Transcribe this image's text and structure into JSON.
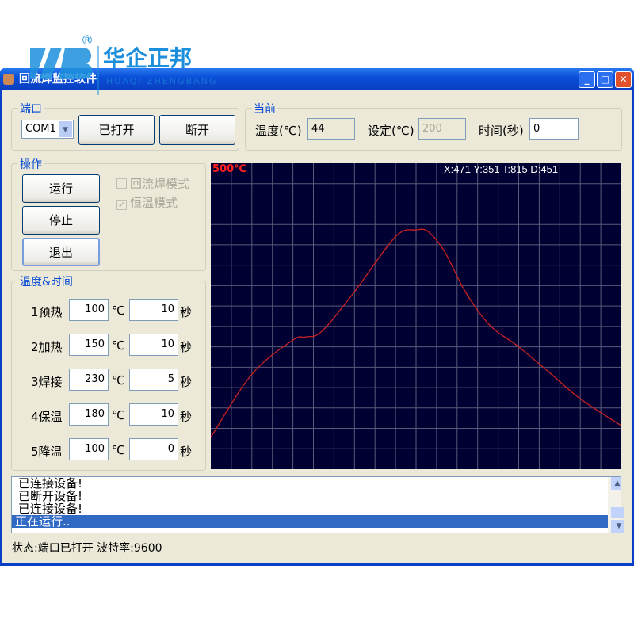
{
  "logo": {
    "brand": "华企正邦",
    "subtitle": "HUAQI ZHENGBANG",
    "mark": "®"
  },
  "window": {
    "title": "回流焊监控软件",
    "min": "_",
    "max": "□",
    "close": "✕"
  },
  "port": {
    "label": "端口",
    "com": "COM1",
    "open_btn": "已打开",
    "close_btn": "断开"
  },
  "current": {
    "label": "当前",
    "temp_label": "温度(℃)",
    "temp": "44",
    "set_label": "设定(℃)",
    "set": "200",
    "time_label": "时间(秒)",
    "time": "0"
  },
  "ops": {
    "label": "操作",
    "run": "运行",
    "stop": "停止",
    "exit": "退出",
    "reflow_mode": "回流焊模式",
    "reflow_checked": false,
    "const_mode": "恒温模式",
    "const_checked": true
  },
  "tt": {
    "label": "温度&时间",
    "unit_c": "℃",
    "unit_s": "秒",
    "rows": [
      {
        "name": "1预热",
        "temp": "100",
        "time": "10"
      },
      {
        "name": "2加热",
        "temp": "150",
        "time": "10"
      },
      {
        "name": "3焊接",
        "temp": "230",
        "time": "5"
      },
      {
        "name": "4保温",
        "temp": "180",
        "time": "10"
      },
      {
        "name": "5降温",
        "temp": "100",
        "time": "0"
      }
    ]
  },
  "chart_data": {
    "type": "line",
    "max_label": "500℃",
    "readout": "X:471 Y:351 T:815 D:451",
    "ylim": [
      0,
      500
    ],
    "grid": true,
    "line_color": "#cc2222",
    "x": [
      0,
      10,
      20,
      23,
      27,
      35,
      45,
      50,
      53,
      57,
      62,
      68,
      75,
      83,
      90,
      100
    ],
    "y": [
      52,
      155,
      211,
      216,
      225,
      290,
      380,
      391,
      388,
      355,
      290,
      235,
      200,
      155,
      115,
      71
    ]
  },
  "log": {
    "lines": [
      "已连接设备!",
      "已断开设备!",
      "已连接设备!"
    ],
    "selected": "正在运行.."
  },
  "status": "状态:端口已打开 波特率:9600"
}
